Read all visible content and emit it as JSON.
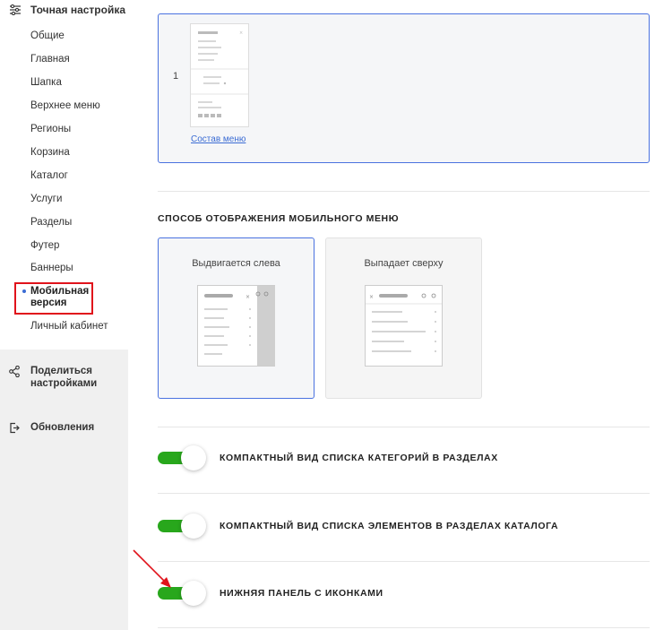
{
  "sidebar": {
    "heading": "Точная настройка",
    "items": [
      {
        "label": "Общие"
      },
      {
        "label": "Главная"
      },
      {
        "label": "Шапка"
      },
      {
        "label": "Верхнее меню"
      },
      {
        "label": "Регионы"
      },
      {
        "label": "Корзина"
      },
      {
        "label": "Каталог"
      },
      {
        "label": "Услуги"
      },
      {
        "label": "Разделы"
      },
      {
        "label": "Футер"
      },
      {
        "label": "Баннеры"
      },
      {
        "label": "Мобильная\nверсия",
        "active": true
      },
      {
        "label": "Личный кабинет"
      }
    ],
    "share": {
      "label_line1": "Поделиться",
      "label_line2": "настройками",
      "icon": "share-icon"
    },
    "updates": {
      "label": "Обновления",
      "icon": "logout-icon"
    },
    "accent_color": "#3b6cd4",
    "highlight_color": "#e0131b"
  },
  "menu_block": {
    "number": "1",
    "link": "Состав меню"
  },
  "mobile_menu": {
    "title": "СПОСОБ ОТОБРАЖЕНИЯ МОБИЛЬНОГО МЕНЮ",
    "options": [
      {
        "label": "Выдвигается слева",
        "selected": true
      },
      {
        "label": "Выпадает сверху",
        "selected": false
      }
    ]
  },
  "toggles": [
    {
      "label": "КОМПАКТНЫЙ ВИД СПИСКА КАТЕГОРИЙ В РАЗДЕЛАХ",
      "on": true
    },
    {
      "label": "КОМПАКТНЫЙ ВИД СПИСКА ЭЛЕМЕНТОВ В РАЗДЕЛАХ КАТАЛОГА",
      "on": true
    },
    {
      "label": "НИЖНЯЯ ПАНЕЛЬ С ИКОНКАМИ",
      "on": true
    }
  ],
  "colors": {
    "toggle_on": "#28a71c",
    "selected_border": "#4a72e0",
    "arrow": "#e0131b"
  }
}
